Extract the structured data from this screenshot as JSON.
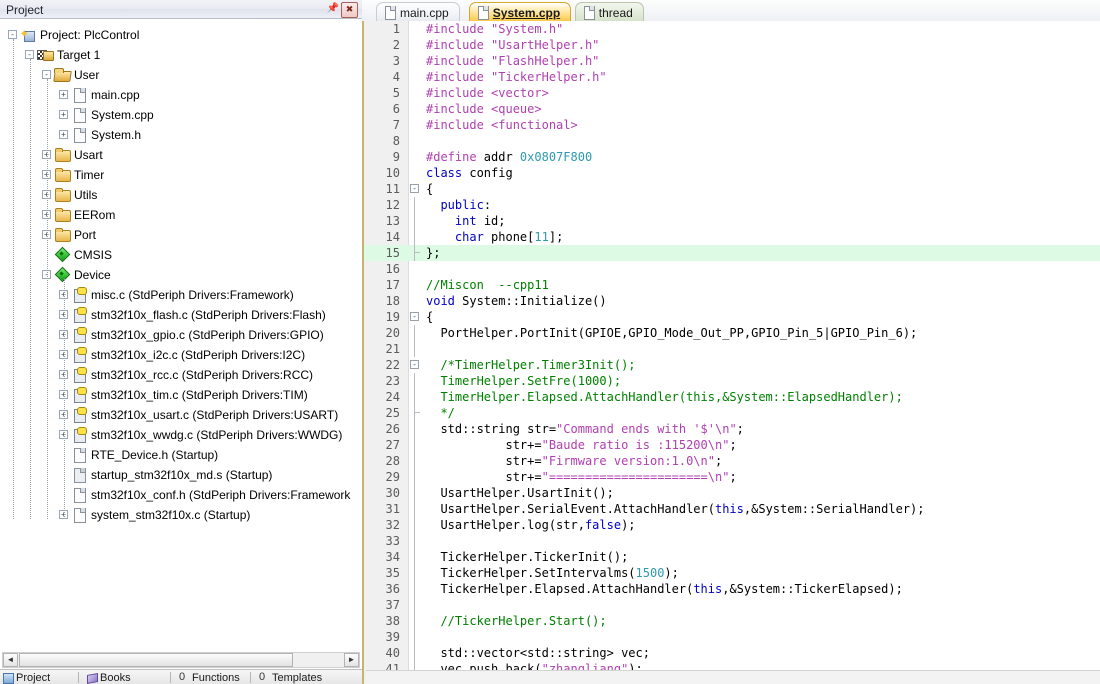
{
  "project_panel": {
    "title": "Project",
    "pin_icon": "pin-icon",
    "close_icon": "close-icon",
    "tree": [
      {
        "depth": 0,
        "expander": "-",
        "icon": "project-icon",
        "label": "Project: PlcControl"
      },
      {
        "depth": 1,
        "expander": "-",
        "icon": "target-icon",
        "label": "Target 1"
      },
      {
        "depth": 2,
        "expander": "-",
        "icon": "folder-open-icon",
        "label": "User"
      },
      {
        "depth": 3,
        "expander": "+",
        "icon": "file-icon",
        "label": "main.cpp"
      },
      {
        "depth": 3,
        "expander": "+",
        "icon": "file-icon",
        "label": "System.cpp"
      },
      {
        "depth": 3,
        "expander": "+",
        "icon": "file-icon",
        "label": "System.h"
      },
      {
        "depth": 2,
        "expander": "+",
        "icon": "folder-icon",
        "label": "Usart"
      },
      {
        "depth": 2,
        "expander": "+",
        "icon": "folder-icon",
        "label": "Timer"
      },
      {
        "depth": 2,
        "expander": "+",
        "icon": "folder-icon",
        "label": "Utils"
      },
      {
        "depth": 2,
        "expander": "+",
        "icon": "folder-icon",
        "label": "EERom"
      },
      {
        "depth": 2,
        "expander": "+",
        "icon": "folder-icon",
        "label": "Port"
      },
      {
        "depth": 2,
        "expander": "",
        "icon": "diamond-icon",
        "label": "CMSIS"
      },
      {
        "depth": 2,
        "expander": "-",
        "icon": "diamond-icon",
        "label": "Device"
      },
      {
        "depth": 3,
        "expander": "+",
        "icon": "source-icon",
        "label": "misc.c (StdPeriph Drivers:Framework)"
      },
      {
        "depth": 3,
        "expander": "+",
        "icon": "source-icon",
        "label": "stm32f10x_flash.c (StdPeriph Drivers:Flash)"
      },
      {
        "depth": 3,
        "expander": "+",
        "icon": "source-icon",
        "label": "stm32f10x_gpio.c (StdPeriph Drivers:GPIO)"
      },
      {
        "depth": 3,
        "expander": "+",
        "icon": "source-icon",
        "label": "stm32f10x_i2c.c (StdPeriph Drivers:I2C)"
      },
      {
        "depth": 3,
        "expander": "+",
        "icon": "source-icon",
        "label": "stm32f10x_rcc.c (StdPeriph Drivers:RCC)"
      },
      {
        "depth": 3,
        "expander": "+",
        "icon": "source-icon",
        "label": "stm32f10x_tim.c (StdPeriph Drivers:TIM)"
      },
      {
        "depth": 3,
        "expander": "+",
        "icon": "source-icon",
        "label": "stm32f10x_usart.c (StdPeriph Drivers:USART)"
      },
      {
        "depth": 3,
        "expander": "+",
        "icon": "source-icon",
        "label": "stm32f10x_wwdg.c (StdPeriph Drivers:WWDG)"
      },
      {
        "depth": 3,
        "expander": "",
        "icon": "file-icon",
        "label": "RTE_Device.h (Startup)"
      },
      {
        "depth": 3,
        "expander": "",
        "icon": "asm-icon",
        "label": "startup_stm32f10x_md.s (Startup)"
      },
      {
        "depth": 3,
        "expander": "",
        "icon": "file-icon",
        "label": "stm32f10x_conf.h (StdPeriph Drivers:Framework"
      },
      {
        "depth": 3,
        "expander": "+",
        "icon": "file-icon",
        "label": "system_stm32f10x.c (Startup)"
      }
    ],
    "hscroll": {
      "left_arrow": "◄",
      "right_arrow": "►"
    }
  },
  "bottom_dock": {
    "tabs": [
      {
        "label": "Project",
        "icon": "project-dock-icon"
      },
      {
        "label": "Books",
        "icon": "books-dock-icon"
      },
      {
        "label": "Functions",
        "icon": "functions-dock-icon"
      },
      {
        "label": "Templates",
        "icon": "templates-dock-icon"
      }
    ]
  },
  "editor": {
    "tabs": [
      {
        "label": "main.cpp",
        "active": false,
        "style": "normal"
      },
      {
        "label": "System.cpp",
        "active": true,
        "style": "active"
      },
      {
        "label": "thread",
        "active": false,
        "style": "green"
      }
    ],
    "current_line": 15,
    "lines": [
      {
        "n": 1,
        "fold": "",
        "tokens": [
          [
            "t-pre",
            "#include "
          ],
          [
            "t-str",
            "\"System.h\""
          ]
        ]
      },
      {
        "n": 2,
        "fold": "",
        "tokens": [
          [
            "t-pre",
            "#include "
          ],
          [
            "t-str",
            "\"UsartHelper.h\""
          ]
        ]
      },
      {
        "n": 3,
        "fold": "",
        "tokens": [
          [
            "t-pre",
            "#include "
          ],
          [
            "t-str",
            "\"FlashHelper.h\""
          ]
        ]
      },
      {
        "n": 4,
        "fold": "",
        "tokens": [
          [
            "t-pre",
            "#include "
          ],
          [
            "t-str",
            "\"TickerHelper.h\""
          ]
        ]
      },
      {
        "n": 5,
        "fold": "",
        "tokens": [
          [
            "t-pre",
            "#include "
          ],
          [
            "t-str",
            "<vector>"
          ]
        ]
      },
      {
        "n": 6,
        "fold": "",
        "tokens": [
          [
            "t-pre",
            "#include "
          ],
          [
            "t-str",
            "<queue>"
          ]
        ]
      },
      {
        "n": 7,
        "fold": "",
        "tokens": [
          [
            "t-pre",
            "#include "
          ],
          [
            "t-str",
            "<functional>"
          ]
        ]
      },
      {
        "n": 8,
        "fold": "",
        "tokens": []
      },
      {
        "n": 9,
        "fold": "",
        "tokens": [
          [
            "t-pre",
            "#define "
          ],
          [
            "t-pln",
            "addr "
          ],
          [
            "t-num",
            "0x0807F800"
          ]
        ]
      },
      {
        "n": 10,
        "fold": "",
        "tokens": [
          [
            "t-kw",
            "class "
          ],
          [
            "t-pln",
            "config"
          ]
        ]
      },
      {
        "n": 11,
        "fold": "-",
        "tokens": [
          [
            "t-pln",
            "{"
          ]
        ]
      },
      {
        "n": 12,
        "fold": "|",
        "tokens": [
          [
            "t-pln",
            "  "
          ],
          [
            "t-kw",
            "public"
          ],
          [
            "t-pln",
            ":"
          ]
        ]
      },
      {
        "n": 13,
        "fold": "|",
        "tokens": [
          [
            "t-pln",
            "    "
          ],
          [
            "t-kw",
            "int "
          ],
          [
            "t-pln",
            "id;"
          ]
        ]
      },
      {
        "n": 14,
        "fold": "|",
        "tokens": [
          [
            "t-pln",
            "    "
          ],
          [
            "t-kw",
            "char "
          ],
          [
            "t-pln",
            "phone["
          ],
          [
            "t-num",
            "11"
          ],
          [
            "t-pln",
            "];"
          ]
        ]
      },
      {
        "n": 15,
        "fold": "e",
        "tokens": [
          [
            "t-pln",
            "};"
          ]
        ]
      },
      {
        "n": 16,
        "fold": "",
        "tokens": []
      },
      {
        "n": 17,
        "fold": "",
        "tokens": [
          [
            "t-cmt",
            "//Miscon  --cpp11"
          ]
        ]
      },
      {
        "n": 18,
        "fold": "",
        "tokens": [
          [
            "t-kw",
            "void "
          ],
          [
            "t-pln",
            "System::Initialize()"
          ]
        ]
      },
      {
        "n": 19,
        "fold": "-",
        "tokens": [
          [
            "t-pln",
            "{"
          ]
        ]
      },
      {
        "n": 20,
        "fold": "|",
        "tokens": [
          [
            "t-pln",
            "  PortHelper.PortInit(GPIOE,GPIO_Mode_Out_PP,GPIO_Pin_5|GPIO_Pin_6);"
          ]
        ]
      },
      {
        "n": 21,
        "fold": "|",
        "tokens": []
      },
      {
        "n": 22,
        "fold": "-",
        "tokens": [
          [
            "t-cmt",
            "  /*TimerHelper.Timer3Init();"
          ]
        ]
      },
      {
        "n": 23,
        "fold": "|",
        "tokens": [
          [
            "t-cmt",
            "  TimerHelper.SetFre(1000);"
          ]
        ]
      },
      {
        "n": 24,
        "fold": "|",
        "tokens": [
          [
            "t-cmt",
            "  TimerHelper.Elapsed.AttachHandler(this,&System::ElapsedHandler);"
          ]
        ]
      },
      {
        "n": 25,
        "fold": "e",
        "tokens": [
          [
            "t-cmt",
            "  */"
          ]
        ]
      },
      {
        "n": 26,
        "fold": "|",
        "tokens": [
          [
            "t-pln",
            "  std::string str="
          ],
          [
            "t-str",
            "\"Command ends with '$'\\n\""
          ],
          [
            "t-pln",
            ";"
          ]
        ]
      },
      {
        "n": 27,
        "fold": "|",
        "tokens": [
          [
            "t-pln",
            "           str+="
          ],
          [
            "t-str",
            "\"Baude ratio is :115200\\n\""
          ],
          [
            "t-pln",
            ";"
          ]
        ]
      },
      {
        "n": 28,
        "fold": "|",
        "tokens": [
          [
            "t-pln",
            "           str+="
          ],
          [
            "t-str",
            "\"Firmware version:1.0\\n\""
          ],
          [
            "t-pln",
            ";"
          ]
        ]
      },
      {
        "n": 29,
        "fold": "|",
        "tokens": [
          [
            "t-pln",
            "           str+="
          ],
          [
            "t-str",
            "\"======================\\n\""
          ],
          [
            "t-pln",
            ";"
          ]
        ]
      },
      {
        "n": 30,
        "fold": "|",
        "tokens": [
          [
            "t-pln",
            "  UsartHelper.UsartInit();"
          ]
        ]
      },
      {
        "n": 31,
        "fold": "|",
        "tokens": [
          [
            "t-pln",
            "  UsartHelper.SerialEvent.AttachHandler("
          ],
          [
            "t-kw",
            "this"
          ],
          [
            "t-pln",
            ",&System::SerialHandler);"
          ]
        ]
      },
      {
        "n": 32,
        "fold": "|",
        "tokens": [
          [
            "t-pln",
            "  UsartHelper.log(str,"
          ],
          [
            "t-kw",
            "false"
          ],
          [
            "t-pln",
            ");"
          ]
        ]
      },
      {
        "n": 33,
        "fold": "|",
        "tokens": []
      },
      {
        "n": 34,
        "fold": "|",
        "tokens": [
          [
            "t-pln",
            "  TickerHelper.TickerInit();"
          ]
        ]
      },
      {
        "n": 35,
        "fold": "|",
        "tokens": [
          [
            "t-pln",
            "  TickerHelper.SetIntervalms("
          ],
          [
            "t-num",
            "1500"
          ],
          [
            "t-pln",
            ");"
          ]
        ]
      },
      {
        "n": 36,
        "fold": "|",
        "tokens": [
          [
            "t-pln",
            "  TickerHelper.Elapsed.AttachHandler("
          ],
          [
            "t-kw",
            "this"
          ],
          [
            "t-pln",
            ",&System::TickerElapsed);"
          ]
        ]
      },
      {
        "n": 37,
        "fold": "|",
        "tokens": []
      },
      {
        "n": 38,
        "fold": "|",
        "tokens": [
          [
            "t-cmt",
            "  //TickerHelper.Start();"
          ]
        ]
      },
      {
        "n": 39,
        "fold": "|",
        "tokens": []
      },
      {
        "n": 40,
        "fold": "|",
        "tokens": [
          [
            "t-pln",
            "  std::vector<std::string> vec;"
          ]
        ]
      },
      {
        "n": 41,
        "fold": "|",
        "tokens": [
          [
            "t-pln",
            "  vec.push_back("
          ],
          [
            "t-str",
            "\"zhangliang\""
          ],
          [
            "t-pln",
            ");"
          ]
        ]
      }
    ]
  },
  "colors": {
    "tab_active": "#fbc94c",
    "current_line": "#ddfbe4",
    "keyword": "#0000c8",
    "string": "#b040b0",
    "comment": "#008000",
    "number": "#2e9ab0",
    "editor_border": "#c8b274"
  }
}
